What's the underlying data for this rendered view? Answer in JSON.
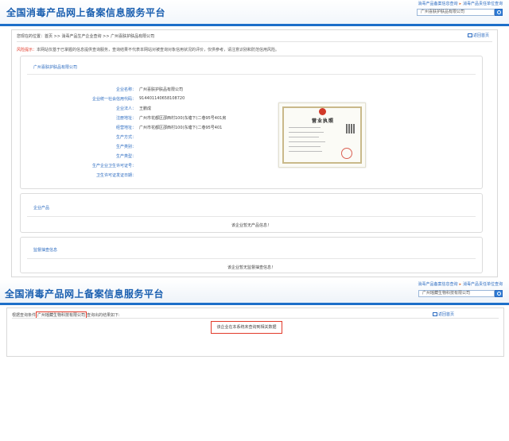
{
  "site": {
    "title": "全国消毒产品网上备案信息服务平台",
    "top_links": [
      "消毒产品备案信息查询",
      "消毒产品责任单位查询"
    ]
  },
  "screen1": {
    "search_value": "广州喜肤护肤品有限公司",
    "breadcrumb": "您现在的位置：首页 >> 消毒产品生产企业查询 >> 广州喜肤护肤品有限公司",
    "back_label": "返回首页",
    "risk_label": "风险提示：",
    "risk_text": "本网站仅基于已掌握的信息提供查询服务，查询结果不代表本网站对被查询对象信用状况的评价，仅供参考，请注意识别和防范信用风险。",
    "company_card": {
      "title": "广州喜肤护肤品有限公司",
      "rows": [
        {
          "label": "企业名称：",
          "value": "广州喜肤护肤品有限公司"
        },
        {
          "label": "企业统一社会信用代码：",
          "value": "914401140658108720"
        },
        {
          "label": "企业法人：",
          "value": "王鹏成"
        },
        {
          "label": "注册地址：",
          "value": "广州市花都区邵西村100(东塘下)二巷95号401房"
        },
        {
          "label": "经营地址：",
          "value": "广州市花都区邵西村100(东塘下)二巷95号401"
        },
        {
          "label": "生产方式：",
          "value": ""
        },
        {
          "label": "生产类别：",
          "value": ""
        },
        {
          "label": "生产类型：",
          "value": ""
        },
        {
          "label": "生产企业卫生许可证号：",
          "value": ""
        },
        {
          "label": "卫生许可证发证日期：",
          "value": ""
        }
      ],
      "license_title": "营业执照"
    },
    "products_card": {
      "title": "企业产品",
      "empty": "该企业暂无产品信息！"
    },
    "inspection_card": {
      "title": "监督抽查信息",
      "empty": "该企业暂无监督抽查信息！"
    }
  },
  "screen2": {
    "search_value": "广州瑶藏生物科技有限公司",
    "result_prefix": "根据查询条件",
    "result_company": "广州瑶藏生物科技有限公司",
    "result_suffix": "查询出的结果如下:",
    "back_label": "返回首页",
    "no_data": "该企业在本系统未查询到相关数据"
  },
  "colors": {
    "brand": "#1a5fb0",
    "bar": "#1d6fc9",
    "link": "#2a6ac0",
    "alert": "#e23a2a"
  }
}
